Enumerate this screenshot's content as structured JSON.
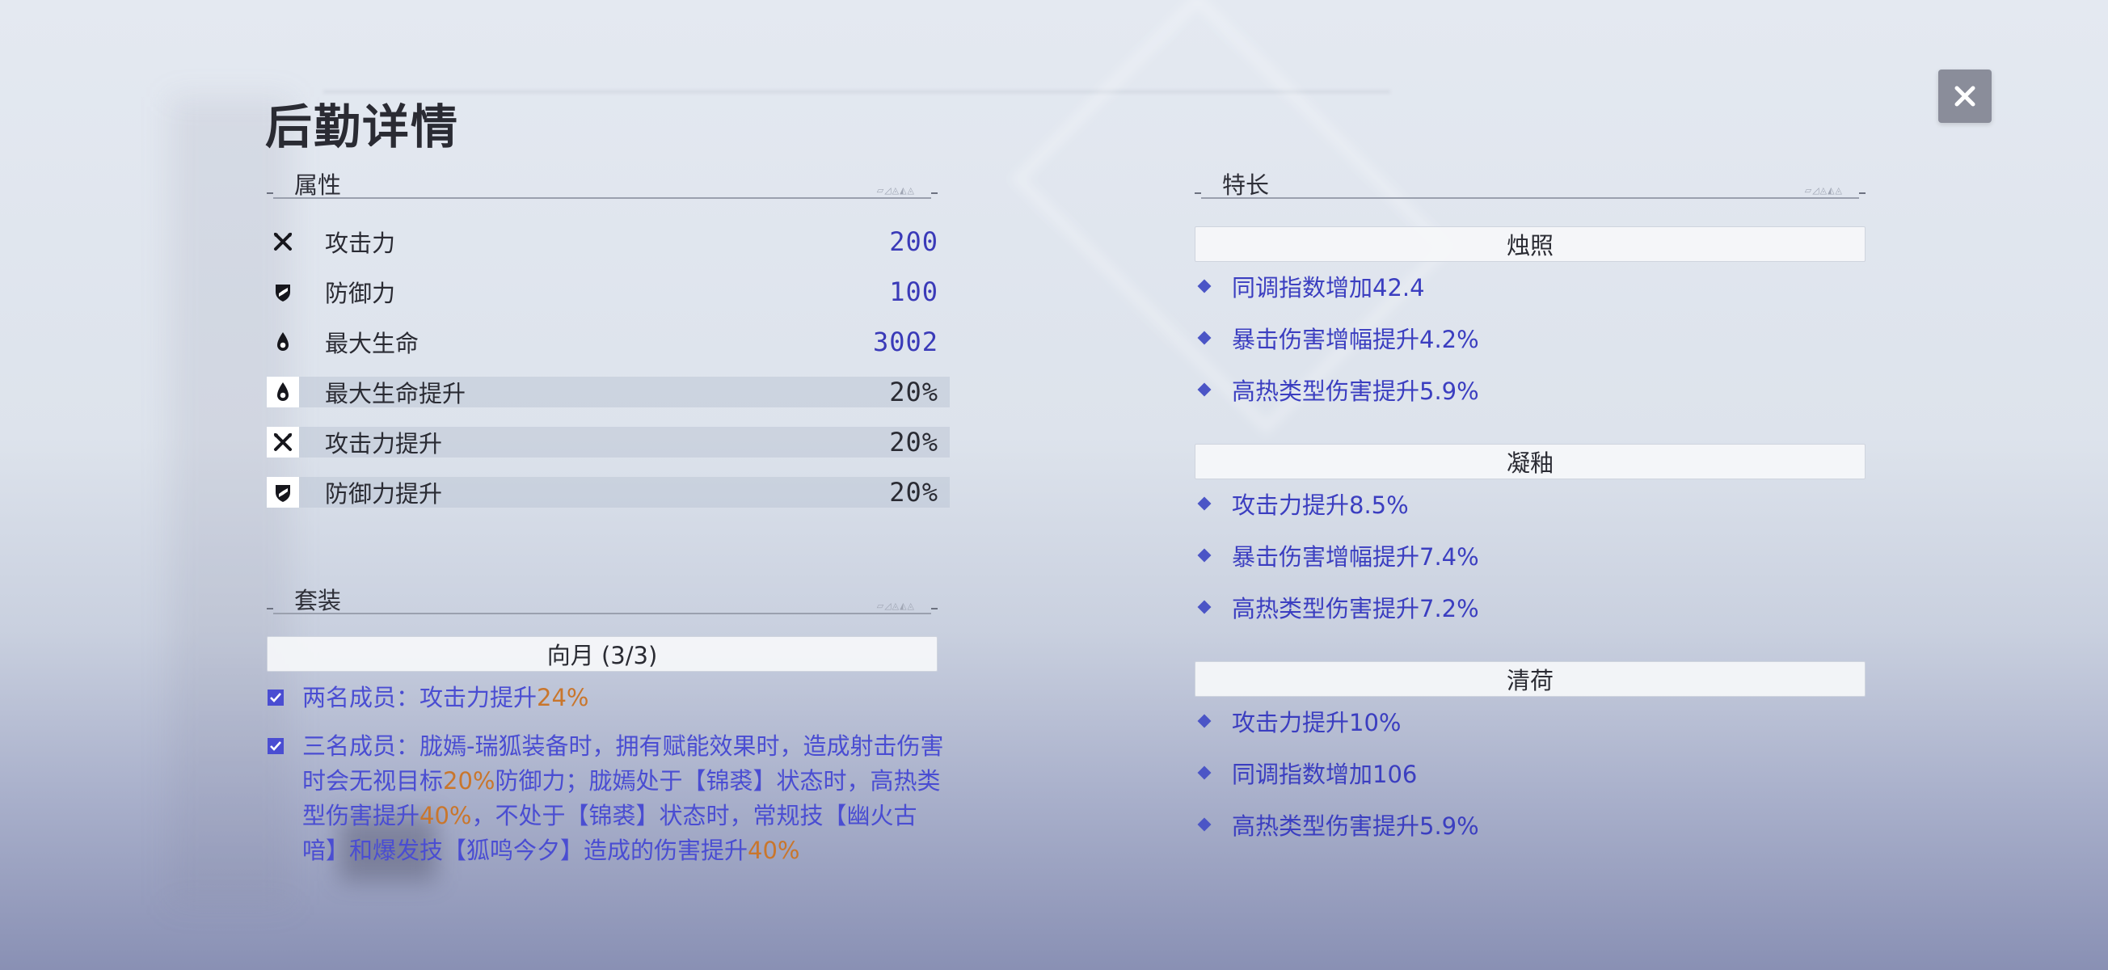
{
  "page_title": "后勤详情",
  "close_label": "✕",
  "attributes": {
    "header": "属性",
    "rows": [
      {
        "icon": "crossed-swords-icon",
        "name": "攻击力",
        "value": "200",
        "highlight": false
      },
      {
        "icon": "shield-icon",
        "name": "防御力",
        "value": "100",
        "highlight": false
      },
      {
        "icon": "blood-drop-icon",
        "name": "最大生命",
        "value": "3002",
        "highlight": false
      },
      {
        "icon": "blood-drop-icon",
        "name": "最大生命提升",
        "value": "20%",
        "highlight": true
      },
      {
        "icon": "crossed-swords-icon",
        "name": "攻击力提升",
        "value": "20%",
        "highlight": true
      },
      {
        "icon": "shield-icon",
        "name": "防御力提升",
        "value": "20%",
        "highlight": true
      }
    ]
  },
  "set": {
    "header": "套装",
    "name": "向月 (3/3)",
    "items": [
      {
        "parts": [
          {
            "t": "两名成员：攻击力提升"
          },
          {
            "t": "24%",
            "hi": true
          }
        ]
      },
      {
        "parts": [
          {
            "t": "三名成员：胧嫣-瑞狐装备时，拥有赋能效果时，造成射击伤害时会无视目标"
          },
          {
            "t": "20%",
            "hi": true
          },
          {
            "t": "防御力；胧嫣处于【锦裘】状态时，高热类型伤害提升"
          },
          {
            "t": "40%",
            "hi": true
          },
          {
            "t": "，不处于【锦裘】状态时，常规技【幽火古喑】和爆发技【狐鸣今夕】造成的伤害提升"
          },
          {
            "t": "40%",
            "hi": true
          }
        ]
      }
    ]
  },
  "specialties": {
    "header": "特长",
    "groups": [
      {
        "name": "烛照",
        "items": [
          "同调指数增加42.4",
          "暴击伤害增幅提升4.2%",
          "高热类型伤害提升5.9%"
        ]
      },
      {
        "name": "凝釉",
        "items": [
          "攻击力提升8.5%",
          "暴击伤害增幅提升7.4%",
          "高热类型伤害提升7.2%"
        ]
      },
      {
        "name": "清荷",
        "items": [
          "攻击力提升10%",
          "同调指数增加106",
          "高热类型伤害提升5.9%"
        ]
      }
    ]
  },
  "colors": {
    "value_blue": "#3a3ab8",
    "set_text": "#4a4dd2",
    "highlight_orange": "#c9762c",
    "specialty_text": "#3b3ec0"
  }
}
